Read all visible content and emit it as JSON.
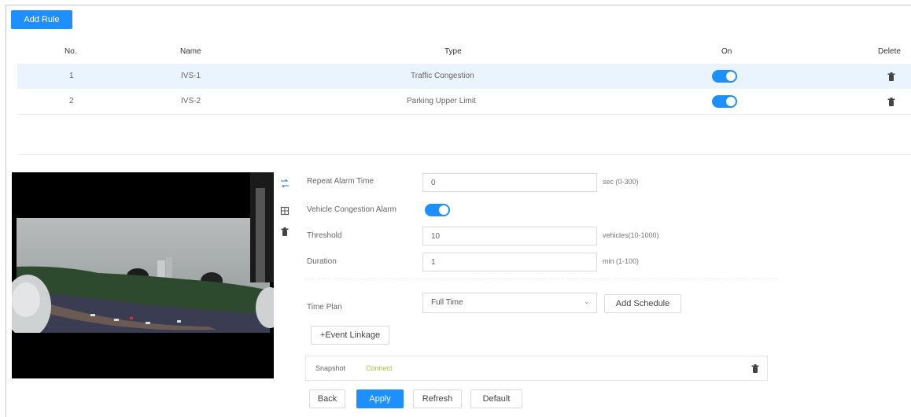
{
  "toolbar": {
    "add_rule_label": "Add Rule"
  },
  "table": {
    "headers": {
      "no": "No.",
      "name": "Name",
      "type": "Type",
      "on": "On",
      "delete": "Delete"
    },
    "rows": [
      {
        "no": "1",
        "name": "IVS-1",
        "type": "Traffic Congestion",
        "on": true
      },
      {
        "no": "2",
        "name": "IVS-2",
        "type": "Parking Upper Limit",
        "on": true
      }
    ]
  },
  "video": {
    "tools": [
      "draw-rule-icon",
      "draw-area-icon",
      "clear-icon"
    ]
  },
  "form": {
    "repeat_alarm": {
      "label": "Repeat Alarm Time",
      "value": "0",
      "hint": "sec (0-300)"
    },
    "vehicle_congestion": {
      "label": "Vehicle Congestion Alarm",
      "on": true
    },
    "threshold": {
      "label": "Threshold",
      "value": "10",
      "hint": "vehicles(10-1000)"
    },
    "duration": {
      "label": "Duration",
      "value": "1",
      "hint": "min (1-100)"
    },
    "time_plan": {
      "label": "Time Plan",
      "value": "Full Time",
      "add_schedule_label": "Add Schedule"
    },
    "event_linkage_label": "+Event Linkage",
    "snapshot": {
      "label": "Snapshot",
      "status": "Connect"
    }
  },
  "actions": {
    "back": "Back",
    "apply": "Apply",
    "refresh": "Refresh",
    "default": "Default"
  },
  "colors": {
    "accent": "#1e8fff",
    "row_highlight": "#eaf4ff",
    "snapshot_status": "#9ccc3b"
  }
}
